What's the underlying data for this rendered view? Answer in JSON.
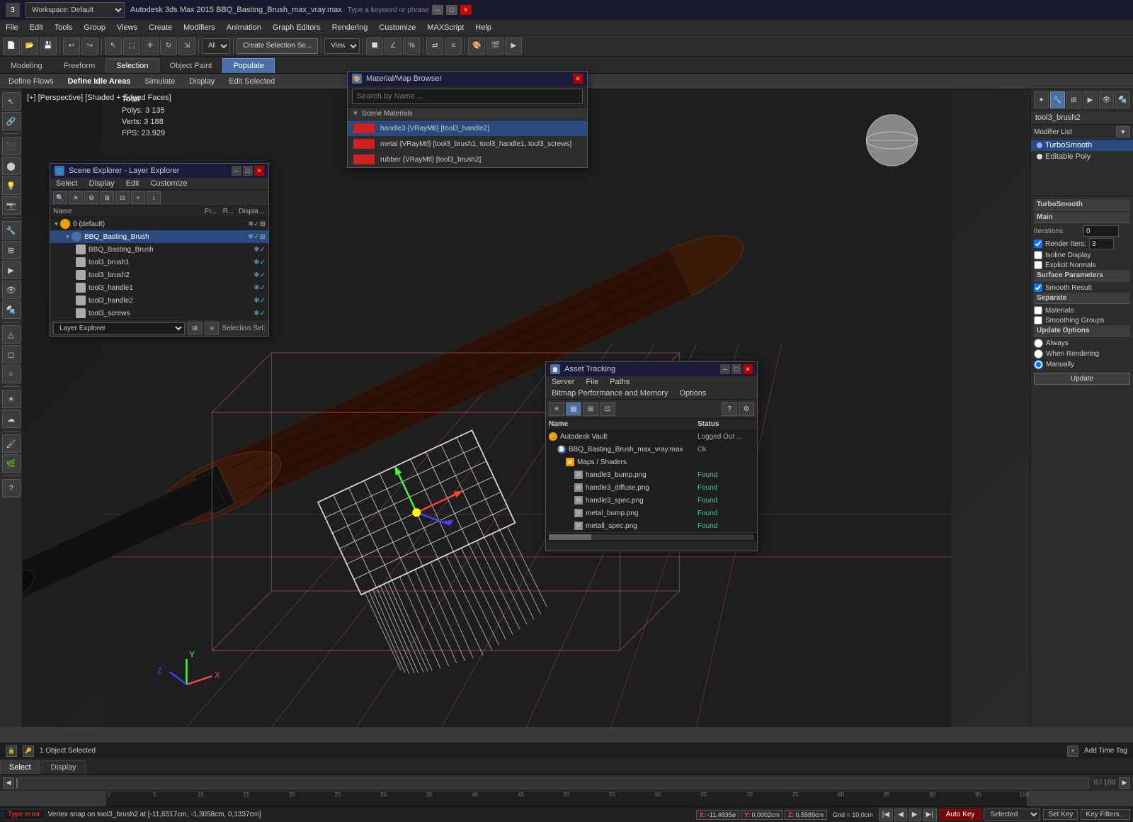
{
  "app": {
    "title": "Autodesk 3ds Max 2015  BBQ_Basting_Brush_max_vray.max",
    "workspace": "Workspace: Default",
    "icon": "3"
  },
  "menu_bar": {
    "items": [
      "File",
      "Edit",
      "Tools",
      "Group",
      "Views",
      "Create",
      "Modifiers",
      "Animation",
      "Graph Editors",
      "Rendering",
      "Customize",
      "MAXScript",
      "Help"
    ]
  },
  "toolbar": {
    "create_selection_label": "Create Selection Se...",
    "view_label": "View"
  },
  "ribbon_tabs": {
    "tabs": [
      "Modeling",
      "Freeform",
      "Selection",
      "Object Paint",
      "Populate"
    ]
  },
  "sub_ribbon": {
    "items": [
      "Define Flows",
      "Define Idle Areas",
      "Simulate",
      "Display",
      "Edit Selected"
    ],
    "active": "Edit Selected"
  },
  "viewport": {
    "label": "[+] [Perspective] [Shaded + Edged Faces]",
    "stats": {
      "total_label": "Total",
      "polys_label": "Polys:",
      "polys_value": "3 135",
      "verts_label": "Verts:",
      "verts_value": "3 188",
      "fps_label": "FPS:",
      "fps_value": "23.929"
    }
  },
  "scene_explorer": {
    "title": "Scene Explorer - Layer Explorer",
    "menus": [
      "Select",
      "Display",
      "Edit",
      "Customize"
    ],
    "columns": [
      "Name",
      "Fr...",
      "R...",
      "Displa..."
    ],
    "items": [
      {
        "label": "0 (default)",
        "type": "layer",
        "indent": 0,
        "expanded": true
      },
      {
        "label": "BBQ_Basting_Brush",
        "type": "layer",
        "indent": 1,
        "expanded": true,
        "selected": true
      },
      {
        "label": "BBQ_Basting_Brush",
        "type": "object",
        "indent": 2
      },
      {
        "label": "tool3_brush1",
        "type": "object",
        "indent": 2
      },
      {
        "label": "tool3_brush2",
        "type": "object",
        "indent": 2
      },
      {
        "label": "tool3_handle1",
        "type": "object",
        "indent": 2
      },
      {
        "label": "tool3_handle2",
        "type": "object",
        "indent": 2
      },
      {
        "label": "tool3_screws",
        "type": "object",
        "indent": 2
      }
    ],
    "footer": {
      "dropdown_label": "Layer Explorer",
      "selection_set_label": "Selection Set:"
    }
  },
  "material_browser": {
    "title": "Material/Map Browser",
    "search_placeholder": "Search by Name ...",
    "section_label": "Scene Materials",
    "items": [
      {
        "label": "handle3 {VRayMtl} [tool3_handle2]",
        "color": "#cc2222"
      },
      {
        "label": "metal {VRayMtl} [tool3_brush1, tool3_handle1, tool3_screws]",
        "color": "#cc2222"
      },
      {
        "label": "rubber {VRayMtl} [tool3_brush2]",
        "color": "#cc2222"
      }
    ]
  },
  "asset_tracking": {
    "title": "Asset Tracking",
    "menus": [
      "Server",
      "File",
      "Paths",
      "Bitmap Performance and Memory",
      "Options"
    ],
    "columns": [
      "Name",
      "Status"
    ],
    "items": [
      {
        "label": "Autodesk Vault",
        "type": "vault",
        "status": "Logged Out ...",
        "indent": 0
      },
      {
        "label": "BBQ_Basting_Brush_max_vray.max",
        "type": "file",
        "status": "Ok",
        "indent": 1
      },
      {
        "label": "Maps / Shaders",
        "type": "folder",
        "status": "",
        "indent": 2
      },
      {
        "label": "handle3_bump.png",
        "type": "image",
        "status": "Found",
        "indent": 3
      },
      {
        "label": "handle3_diffuse.png",
        "type": "image",
        "status": "Found",
        "indent": 3
      },
      {
        "label": "handle3_spec.png",
        "type": "image",
        "status": "Found",
        "indent": 3
      },
      {
        "label": "metal_bump.png",
        "type": "image",
        "status": "Found",
        "indent": 3
      },
      {
        "label": "metall_spec.png",
        "type": "image",
        "status": "Found",
        "indent": 3
      }
    ]
  },
  "right_panel": {
    "object_name": "tool3_brush2",
    "modifier_list_label": "Modifier List",
    "modifiers": [
      {
        "label": "TurboSmooth",
        "active": true
      },
      {
        "label": "Editable Poly"
      }
    ],
    "turbosmooth": {
      "section": "TurboSmooth",
      "main_label": "Main",
      "iterations_label": "Iterations:",
      "iterations_value": "0",
      "render_iters_label": "Render Iters:",
      "render_iters_value": "3",
      "isoline_label": "Isoline Display",
      "explicit_label": "Explicit Normals",
      "surface_label": "Surface Parameters",
      "smooth_result_label": "Smooth Result",
      "separate_label": "Separate",
      "materials_label": "Materials",
      "smoothing_label": "Smoothing Groups",
      "update_label": "Update Options",
      "always_label": "Always",
      "when_rendering_label": "When Rendering",
      "manually_label": "Manually",
      "update_btn_label": "Update"
    }
  },
  "status_bar": {
    "error_label": "Type error",
    "object_count": "1 Object Selected",
    "coords_label": "Vertex snap on tool3_brush2 at [-11,6517cm, -1,3058cm, 0,1337cm]",
    "x_label": "X:",
    "x_value": "-11,4835ø",
    "y_label": "Y:",
    "y_value": "0,0002cm",
    "z_label": "Z:",
    "z_value": "0,5589cm",
    "grid_label": "Grid = 10,0cm",
    "autokey_label": "Auto Key",
    "selected_label": "Selected",
    "set_key_label": "Set Key",
    "key_filters_label": "Key Filters..."
  },
  "timeline": {
    "current": "0",
    "total": "100",
    "label": "0 / 100",
    "ticks": [
      0,
      5,
      10,
      15,
      20,
      25,
      30,
      35,
      40,
      45,
      50,
      55,
      60,
      65,
      70,
      75,
      80,
      85,
      90,
      95,
      100
    ]
  },
  "bottom_tabs": {
    "tabs": [
      "Select",
      "Display"
    ]
  }
}
